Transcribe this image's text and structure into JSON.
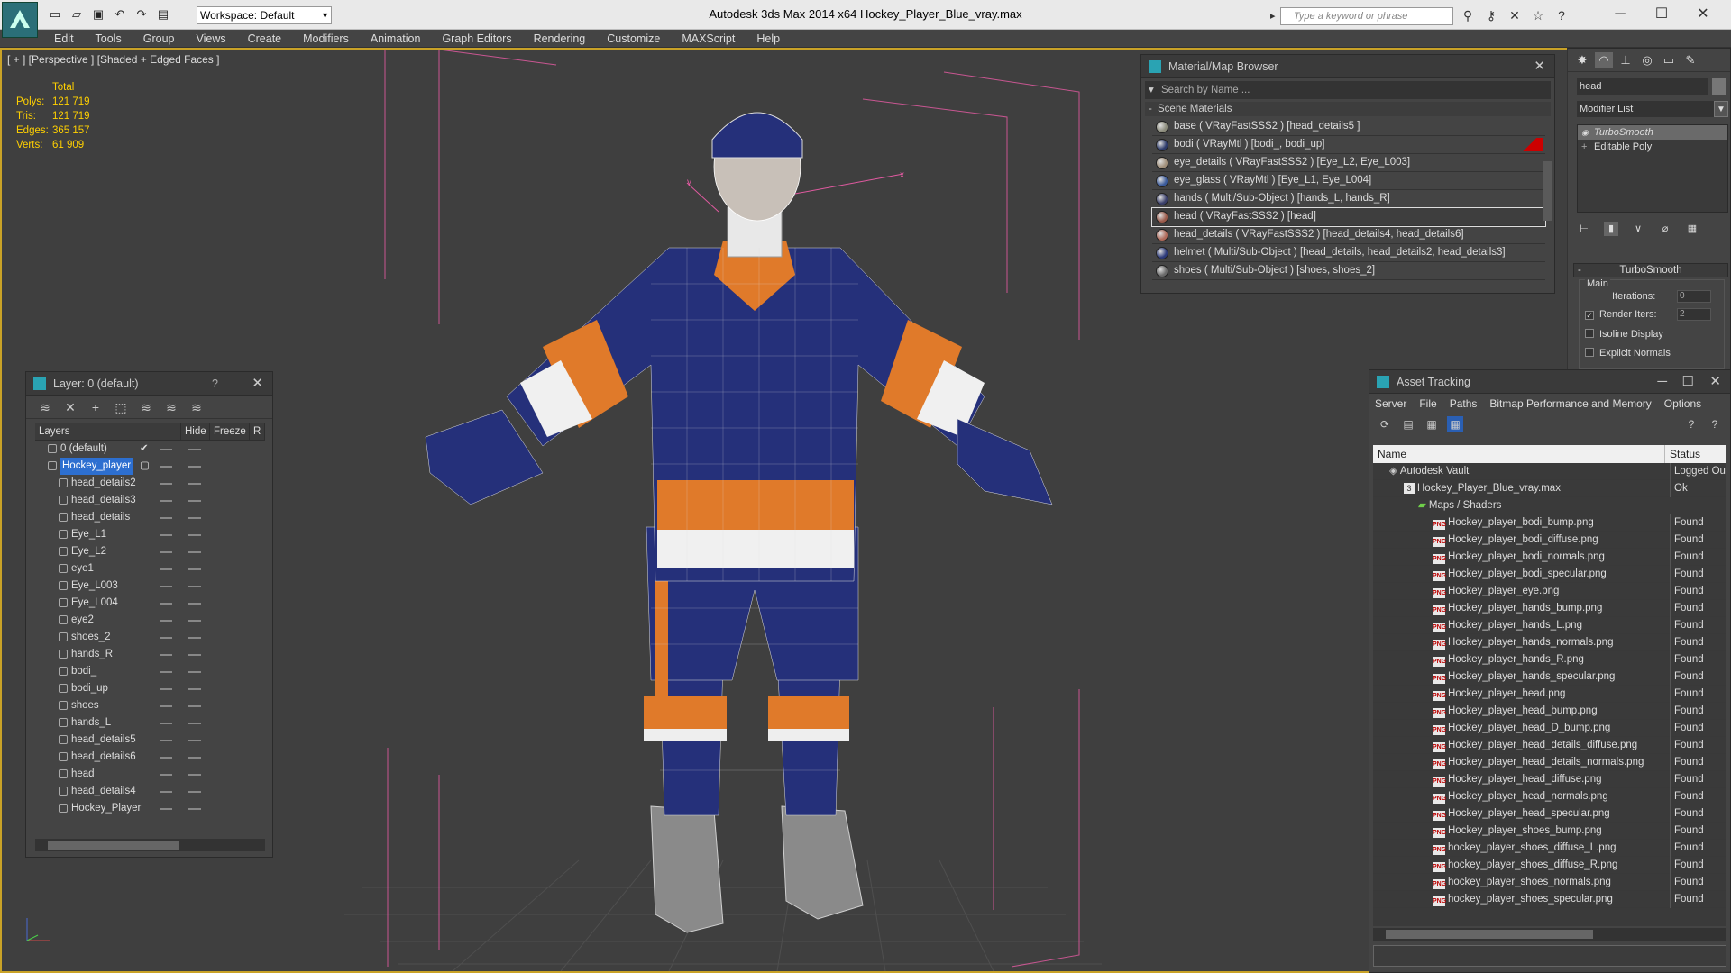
{
  "app": {
    "title": "Autodesk 3ds Max  2014 x64     Hockey_Player_Blue_vray.max",
    "workspace": "Workspace: Default",
    "search_placeholder": "Type a keyword or phrase"
  },
  "menu": [
    "Edit",
    "Tools",
    "Group",
    "Views",
    "Create",
    "Modifiers",
    "Animation",
    "Graph Editors",
    "Rendering",
    "Customize",
    "MAXScript",
    "Help"
  ],
  "viewport": {
    "label": "[ + ] [Perspective ] [Shaded + Edged Faces ]",
    "stats_header": "Total",
    "stats": [
      {
        "k": "Polys:",
        "v": "121 719"
      },
      {
        "k": "Tris:",
        "v": "121 719"
      },
      {
        "k": "Edges:",
        "v": "365 157"
      },
      {
        "k": "Verts:",
        "v": "61 909"
      }
    ],
    "axis_y": "y",
    "axis_x": "x"
  },
  "material_browser": {
    "title": "Material/Map Browser",
    "search": "Search by Name ...",
    "section": "Scene Materials",
    "items": [
      {
        "label": "base  ( VRayFastSSS2 )  [head_details5 ]",
        "color": "#8a8a7a"
      },
      {
        "label": "bodi  ( VRayMtl )  [bodi_, bodi_up]",
        "color": "#2c3a6a"
      },
      {
        "label": "eye_details  ( VRayFastSSS2 )  [Eye_L2, Eye_L003]",
        "color": "#a08f7a"
      },
      {
        "label": "eye_glass  ( VRayMtl )  [Eye_L1, Eye_L004]",
        "color": "#3a5a9a"
      },
      {
        "label": "hands  ( Multi/Sub-Object )  [hands_L, hands_R]",
        "color": "#3a3f6a"
      },
      {
        "label": "head  ( VRayFastSSS2 )  [head]",
        "color": "#9a5a4a"
      },
      {
        "label": "head_details  ( VRayFastSSS2 )  [head_details4, head_details6]",
        "color": "#b06a5a"
      },
      {
        "label": "helmet  ( Multi/Sub-Object )  [head_details, head_details2, head_details3]",
        "color": "#2c3a7a"
      },
      {
        "label": "shoes  ( Multi/Sub-Object )  [shoes, shoes_2]",
        "color": "#6a6a6a"
      }
    ],
    "selected_index": 5
  },
  "command_panel": {
    "object_name": "head",
    "modifier_list": "Modifier List",
    "stack": [
      "TurboSmooth",
      "Editable Poly"
    ],
    "rollout": "TurboSmooth",
    "group": "Main",
    "iterations_label": "Iterations:",
    "iterations": "0",
    "render_iters_label": "Render Iters:",
    "render_iters": "2",
    "isoline": "Isoline Display",
    "explicit_normals": "Explicit Normals"
  },
  "layer_panel": {
    "title": "Layer: 0 (default)",
    "help": "?",
    "columns": [
      "Layers",
      "Hide",
      "Freeze",
      "R"
    ],
    "rows": [
      {
        "name": "0 (default)",
        "indent": 1,
        "check": "✔",
        "sel": false
      },
      {
        "name": "Hockey_player",
        "indent": 1,
        "check": "▢",
        "sel": true
      },
      {
        "name": "head_details2",
        "indent": 2
      },
      {
        "name": "head_details3",
        "indent": 2
      },
      {
        "name": "head_details",
        "indent": 2
      },
      {
        "name": "Eye_L1",
        "indent": 2
      },
      {
        "name": "Eye_L2",
        "indent": 2
      },
      {
        "name": "eye1",
        "indent": 2
      },
      {
        "name": "Eye_L003",
        "indent": 2
      },
      {
        "name": "Eye_L004",
        "indent": 2
      },
      {
        "name": "eye2",
        "indent": 2
      },
      {
        "name": "shoes_2",
        "indent": 2
      },
      {
        "name": "hands_R",
        "indent": 2
      },
      {
        "name": "bodi_",
        "indent": 2
      },
      {
        "name": "bodi_up",
        "indent": 2
      },
      {
        "name": "shoes",
        "indent": 2
      },
      {
        "name": "hands_L",
        "indent": 2
      },
      {
        "name": "head_details5",
        "indent": 2
      },
      {
        "name": "head_details6",
        "indent": 2
      },
      {
        "name": "head",
        "indent": 2
      },
      {
        "name": "head_details4",
        "indent": 2
      },
      {
        "name": "Hockey_Player",
        "indent": 2
      }
    ]
  },
  "asset_tracking": {
    "title": "Asset Tracking",
    "menu": [
      "Server",
      "File",
      "Paths",
      "Bitmap Performance and Memory",
      "Options"
    ],
    "columns": [
      "Name",
      "Status"
    ],
    "rows": [
      {
        "name": "Autodesk Vault",
        "status": "Logged Ou",
        "type": "vault",
        "indent": 0
      },
      {
        "name": "Hockey_Player_Blue_vray.max",
        "status": "Ok",
        "type": "max",
        "indent": 1
      },
      {
        "name": "Maps / Shaders",
        "status": "",
        "type": "folder",
        "indent": 2
      },
      {
        "name": "Hockey_player_bodi_bump.png",
        "status": "Found",
        "type": "png",
        "indent": 3
      },
      {
        "name": "Hockey_player_bodi_diffuse.png",
        "status": "Found",
        "type": "png",
        "indent": 3
      },
      {
        "name": "Hockey_player_bodi_normals.png",
        "status": "Found",
        "type": "png",
        "indent": 3
      },
      {
        "name": "Hockey_player_bodi_specular.png",
        "status": "Found",
        "type": "png",
        "indent": 3
      },
      {
        "name": "Hockey_player_eye.png",
        "status": "Found",
        "type": "png",
        "indent": 3
      },
      {
        "name": "Hockey_player_hands_bump.png",
        "status": "Found",
        "type": "png",
        "indent": 3
      },
      {
        "name": "Hockey_player_hands_L.png",
        "status": "Found",
        "type": "png",
        "indent": 3
      },
      {
        "name": "Hockey_player_hands_normals.png",
        "status": "Found",
        "type": "png",
        "indent": 3
      },
      {
        "name": "Hockey_player_hands_R.png",
        "status": "Found",
        "type": "png",
        "indent": 3
      },
      {
        "name": "Hockey_player_hands_specular.png",
        "status": "Found",
        "type": "png",
        "indent": 3
      },
      {
        "name": "Hockey_player_head.png",
        "status": "Found",
        "type": "png",
        "indent": 3
      },
      {
        "name": "Hockey_player_head_bump.png",
        "status": "Found",
        "type": "png",
        "indent": 3
      },
      {
        "name": "Hockey_player_head_D_bump.png",
        "status": "Found",
        "type": "png",
        "indent": 3
      },
      {
        "name": "Hockey_player_head_details_diffuse.png",
        "status": "Found",
        "type": "png",
        "indent": 3
      },
      {
        "name": "Hockey_player_head_details_normals.png",
        "status": "Found",
        "type": "png",
        "indent": 3
      },
      {
        "name": "Hockey_player_head_diffuse.png",
        "status": "Found",
        "type": "png",
        "indent": 3
      },
      {
        "name": "Hockey_player_head_normals.png",
        "status": "Found",
        "type": "png",
        "indent": 3
      },
      {
        "name": "Hockey_player_head_specular.png",
        "status": "Found",
        "type": "png",
        "indent": 3
      },
      {
        "name": "Hockey_player_shoes_bump.png",
        "status": "Found",
        "type": "png",
        "indent": 3
      },
      {
        "name": "hockey_player_shoes_diffuse_L.png",
        "status": "Found",
        "type": "png",
        "indent": 3
      },
      {
        "name": "hockey_player_shoes_diffuse_R.png",
        "status": "Found",
        "type": "png",
        "indent": 3
      },
      {
        "name": "hockey_player_shoes_normals.png",
        "status": "Found",
        "type": "png",
        "indent": 3
      },
      {
        "name": "hockey_player_shoes_specular.png",
        "status": "Found",
        "type": "png",
        "indent": 3
      }
    ]
  },
  "colors": {
    "accent": "#c9a227",
    "selection": "#2d6fd0",
    "jersey_blue": "#25307a",
    "jersey_orange": "#e07a2a",
    "stats": "#ffd000"
  }
}
